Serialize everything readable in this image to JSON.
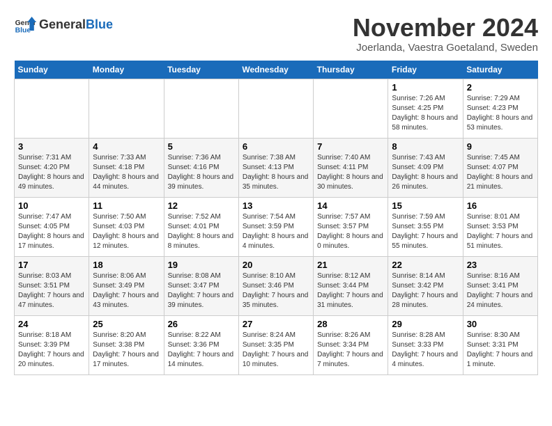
{
  "logo": {
    "general": "General",
    "blue": "Blue"
  },
  "header": {
    "month": "November 2024",
    "location": "Joerlanda, Vaestra Goetaland, Sweden"
  },
  "weekdays": [
    "Sunday",
    "Monday",
    "Tuesday",
    "Wednesday",
    "Thursday",
    "Friday",
    "Saturday"
  ],
  "weeks": [
    [
      {
        "day": "",
        "info": ""
      },
      {
        "day": "",
        "info": ""
      },
      {
        "day": "",
        "info": ""
      },
      {
        "day": "",
        "info": ""
      },
      {
        "day": "",
        "info": ""
      },
      {
        "day": "1",
        "info": "Sunrise: 7:26 AM\nSunset: 4:25 PM\nDaylight: 8 hours\nand 58 minutes."
      },
      {
        "day": "2",
        "info": "Sunrise: 7:29 AM\nSunset: 4:23 PM\nDaylight: 8 hours\nand 53 minutes."
      }
    ],
    [
      {
        "day": "3",
        "info": "Sunrise: 7:31 AM\nSunset: 4:20 PM\nDaylight: 8 hours\nand 49 minutes."
      },
      {
        "day": "4",
        "info": "Sunrise: 7:33 AM\nSunset: 4:18 PM\nDaylight: 8 hours\nand 44 minutes."
      },
      {
        "day": "5",
        "info": "Sunrise: 7:36 AM\nSunset: 4:16 PM\nDaylight: 8 hours\nand 39 minutes."
      },
      {
        "day": "6",
        "info": "Sunrise: 7:38 AM\nSunset: 4:13 PM\nDaylight: 8 hours\nand 35 minutes."
      },
      {
        "day": "7",
        "info": "Sunrise: 7:40 AM\nSunset: 4:11 PM\nDaylight: 8 hours\nand 30 minutes."
      },
      {
        "day": "8",
        "info": "Sunrise: 7:43 AM\nSunset: 4:09 PM\nDaylight: 8 hours\nand 26 minutes."
      },
      {
        "day": "9",
        "info": "Sunrise: 7:45 AM\nSunset: 4:07 PM\nDaylight: 8 hours\nand 21 minutes."
      }
    ],
    [
      {
        "day": "10",
        "info": "Sunrise: 7:47 AM\nSunset: 4:05 PM\nDaylight: 8 hours\nand 17 minutes."
      },
      {
        "day": "11",
        "info": "Sunrise: 7:50 AM\nSunset: 4:03 PM\nDaylight: 8 hours\nand 12 minutes."
      },
      {
        "day": "12",
        "info": "Sunrise: 7:52 AM\nSunset: 4:01 PM\nDaylight: 8 hours\nand 8 minutes."
      },
      {
        "day": "13",
        "info": "Sunrise: 7:54 AM\nSunset: 3:59 PM\nDaylight: 8 hours\nand 4 minutes."
      },
      {
        "day": "14",
        "info": "Sunrise: 7:57 AM\nSunset: 3:57 PM\nDaylight: 8 hours\nand 0 minutes."
      },
      {
        "day": "15",
        "info": "Sunrise: 7:59 AM\nSunset: 3:55 PM\nDaylight: 7 hours\nand 55 minutes."
      },
      {
        "day": "16",
        "info": "Sunrise: 8:01 AM\nSunset: 3:53 PM\nDaylight: 7 hours\nand 51 minutes."
      }
    ],
    [
      {
        "day": "17",
        "info": "Sunrise: 8:03 AM\nSunset: 3:51 PM\nDaylight: 7 hours\nand 47 minutes."
      },
      {
        "day": "18",
        "info": "Sunrise: 8:06 AM\nSunset: 3:49 PM\nDaylight: 7 hours\nand 43 minutes."
      },
      {
        "day": "19",
        "info": "Sunrise: 8:08 AM\nSunset: 3:47 PM\nDaylight: 7 hours\nand 39 minutes."
      },
      {
        "day": "20",
        "info": "Sunrise: 8:10 AM\nSunset: 3:46 PM\nDaylight: 7 hours\nand 35 minutes."
      },
      {
        "day": "21",
        "info": "Sunrise: 8:12 AM\nSunset: 3:44 PM\nDaylight: 7 hours\nand 31 minutes."
      },
      {
        "day": "22",
        "info": "Sunrise: 8:14 AM\nSunset: 3:42 PM\nDaylight: 7 hours\nand 28 minutes."
      },
      {
        "day": "23",
        "info": "Sunrise: 8:16 AM\nSunset: 3:41 PM\nDaylight: 7 hours\nand 24 minutes."
      }
    ],
    [
      {
        "day": "24",
        "info": "Sunrise: 8:18 AM\nSunset: 3:39 PM\nDaylight: 7 hours\nand 20 minutes."
      },
      {
        "day": "25",
        "info": "Sunrise: 8:20 AM\nSunset: 3:38 PM\nDaylight: 7 hours\nand 17 minutes."
      },
      {
        "day": "26",
        "info": "Sunrise: 8:22 AM\nSunset: 3:36 PM\nDaylight: 7 hours\nand 14 minutes."
      },
      {
        "day": "27",
        "info": "Sunrise: 8:24 AM\nSunset: 3:35 PM\nDaylight: 7 hours\nand 10 minutes."
      },
      {
        "day": "28",
        "info": "Sunrise: 8:26 AM\nSunset: 3:34 PM\nDaylight: 7 hours\nand 7 minutes."
      },
      {
        "day": "29",
        "info": "Sunrise: 8:28 AM\nSunset: 3:33 PM\nDaylight: 7 hours\nand 4 minutes."
      },
      {
        "day": "30",
        "info": "Sunrise: 8:30 AM\nSunset: 3:31 PM\nDaylight: 7 hours\nand 1 minute."
      }
    ]
  ]
}
